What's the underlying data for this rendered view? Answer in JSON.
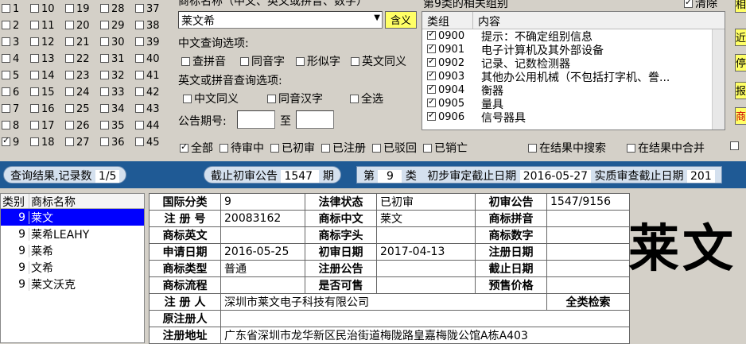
{
  "class_grid": {
    "col1": [
      {
        "n": "1",
        "c": false
      },
      {
        "n": "2",
        "c": false
      },
      {
        "n": "3",
        "c": false
      },
      {
        "n": "4",
        "c": false
      },
      {
        "n": "5",
        "c": false
      },
      {
        "n": "6",
        "c": false
      },
      {
        "n": "7",
        "c": false
      },
      {
        "n": "8",
        "c": false
      },
      {
        "n": "9",
        "c": true
      }
    ],
    "col2": [
      "10",
      "11",
      "12",
      "13",
      "14",
      "15",
      "16",
      "17",
      "18"
    ],
    "col3": [
      "19",
      "20",
      "21",
      "22",
      "23",
      "24",
      "25",
      "26",
      "27"
    ],
    "col4": [
      "28",
      "29",
      "30",
      "31",
      "32",
      "33",
      "34",
      "35",
      "36"
    ],
    "col5": [
      "37",
      "38",
      "39",
      "40",
      "41",
      "42",
      "43",
      "44",
      "45"
    ]
  },
  "search": {
    "name_label": "商标名称（中文、英文或拼音、数字）",
    "name_value": "莱文希",
    "match_button": "含义",
    "cn_options_title": "中文查询选项:",
    "cn_options": [
      "查拼音",
      "同音字",
      "形似字",
      "英文同义"
    ],
    "en_options_title": "英文或拼音查询选项:",
    "en_options": [
      "中文同义",
      "同音汉字",
      "全选"
    ],
    "issue_label": "公告期号:",
    "issue_to": "至"
  },
  "groups": {
    "title": "第9类的相关组别",
    "clear_label": "清除",
    "col_group": "类组",
    "col_content": "内容",
    "rows": [
      {
        "code": "0900",
        "desc": "提示：不确定组别信息"
      },
      {
        "code": "0901",
        "desc": "电子计算机及其外部设备"
      },
      {
        "code": "0902",
        "desc": "记录、记数检测器"
      },
      {
        "code": "0903",
        "desc": "其他办公用机械（不包括打字机、誊..."
      },
      {
        "code": "0904",
        "desc": "衡器"
      },
      {
        "code": "0905",
        "desc": "量具"
      },
      {
        "code": "0906",
        "desc": "信号器具"
      }
    ]
  },
  "status_filters": [
    "全部",
    "待审中",
    "已初审",
    "已注册",
    "已驳回",
    "已销亡"
  ],
  "result_filters": [
    "在结果中搜索",
    "在结果中合并"
  ],
  "info_bar": {
    "result_label": "查询结果,记录数",
    "result_value": "1/5",
    "deadline_label": "截止初审公告",
    "deadline_value": "1547",
    "deadline_unit": "期",
    "class_prefix": "第",
    "class_value": "9",
    "class_suffix": "类",
    "prelim_label": "初步审定截止日期",
    "prelim_value": "2016-05-27",
    "substantive_label": "实质审查截止日期",
    "substantive_value": "201"
  },
  "names_list": {
    "col_class": "类别",
    "col_name": "商标名称",
    "rows": [
      {
        "cls": "9",
        "name": "莱文"
      },
      {
        "cls": "9",
        "name": "莱希LEAHY"
      },
      {
        "cls": "9",
        "name": "莱希"
      },
      {
        "cls": "9",
        "name": "文希"
      },
      {
        "cls": "9",
        "name": "莱文沃克"
      }
    ]
  },
  "detail": {
    "intl_class_k": "国际分类",
    "intl_class_v": "9",
    "legal_status_k": "法律状态",
    "legal_status_v": "已初审",
    "prelim_pub_k": "初审公告",
    "prelim_pub_v": "1547/9156",
    "reg_no_k": "注 册 号",
    "reg_no_v": "20083162",
    "mark_cn_k": "商标中文",
    "mark_cn_v": "莱文",
    "mark_py_k": "商标拼音",
    "mark_py_v": "",
    "mark_en_k": "商标英文",
    "mark_en_v": "",
    "mark_head_k": "商标字头",
    "mark_head_v": "",
    "mark_num_k": "商标数字",
    "mark_num_v": "",
    "apply_date_k": "申请日期",
    "apply_date_v": "2016-05-25",
    "prelim_date_k": "初审日期",
    "prelim_date_v": "2017-04-13",
    "reg_date_k": "注册日期",
    "reg_date_v": "",
    "mark_type_k": "商标类型",
    "mark_type_v": "普通",
    "reg_pub_k": "注册公告",
    "reg_pub_v": "",
    "expire_k": "截止日期",
    "expire_v": "",
    "flow_k": "商标流程",
    "flow_v": "",
    "for_sale_k": "是否可售",
    "for_sale_v": "",
    "presale_k": "预售价格",
    "presale_v": "",
    "registrant_k": "注 册 人",
    "registrant_v": "深圳市莱文电子科技有限公司",
    "all_class_search": "全类检索",
    "orig_registrant_k": "原注册人",
    "orig_registrant_v": "",
    "address_k": "注册地址",
    "address_v": "广东省深圳市龙华新区民治街道梅陇路皇嘉梅陇公馆A栋A403"
  },
  "logo_text": "莱文",
  "right_buttons": [
    "相",
    "近",
    "停",
    "报",
    "商"
  ]
}
